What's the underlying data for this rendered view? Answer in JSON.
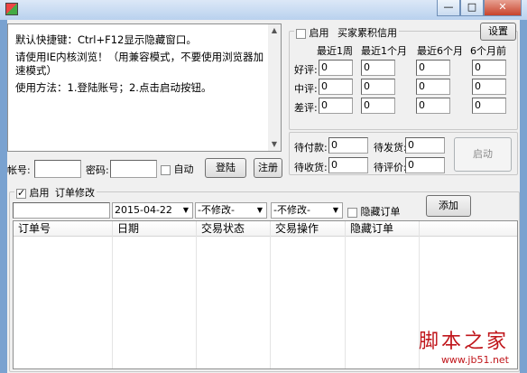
{
  "window": {
    "minimize": "—",
    "maximize": "□",
    "close": "✕"
  },
  "notice": {
    "line1": "默认快捷键：Ctrl+F12显示隐藏窗口。",
    "line2": "请使用IE内核浏览！（用兼容模式，不要使用浏览器加速模式）",
    "line3": "使用方法：1.登陆账号；2.点击启动按钮。"
  },
  "credit": {
    "enable_label": "启用",
    "group_title": "买家累积信用",
    "settings_button": "设置",
    "columns": [
      "最近1周",
      "最近1个月",
      "最近6个月",
      "6个月前"
    ],
    "rows": [
      {
        "label": "好评:",
        "values": [
          "0",
          "0",
          "0",
          "0"
        ]
      },
      {
        "label": "中评:",
        "values": [
          "0",
          "0",
          "0",
          "0"
        ]
      },
      {
        "label": "差评:",
        "values": [
          "0",
          "0",
          "0",
          "0"
        ]
      }
    ]
  },
  "stats": {
    "pending_payment_label": "待付款:",
    "pending_payment": "0",
    "pending_ship_label": "待发货:",
    "pending_ship": "0",
    "pending_receive_label": "待收货:",
    "pending_receive": "0",
    "pending_review_label": "待评价:",
    "pending_review": "0",
    "start_button": "启动"
  },
  "login": {
    "account_label": "帐号:",
    "password_label": "密码:",
    "auto_label": "自动",
    "login_button": "登陆",
    "register_button": "注册"
  },
  "orders": {
    "enable_label": "启用",
    "group_title": "订单修改",
    "date_value": "2015-04-22",
    "select1": "-不修改-",
    "select2": "-不修改-",
    "hide_label": "隐藏订单",
    "add_button": "添加",
    "columns": [
      "订单号",
      "日期",
      "交易状态",
      "交易操作",
      "隐藏订单"
    ]
  },
  "watermark": {
    "title": "脚本之家",
    "url": "www.jb51.net"
  }
}
